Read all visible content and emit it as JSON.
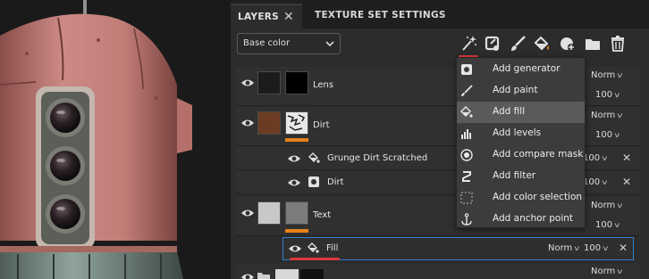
{
  "tabs": {
    "layers": "LAYERS",
    "layers_close": "✕",
    "texture_set_settings": "TEXTURE SET SETTINGS"
  },
  "channel": {
    "selected": "Base color"
  },
  "toolbar_icons": [
    "magic-wand-icon",
    "paint-bucket-add-icon",
    "brush-icon",
    "fill-icon",
    "mask-icon",
    "folder-icon",
    "trash-icon"
  ],
  "add_menu": {
    "items": [
      {
        "label": "Add generator",
        "icon": "generator-icon",
        "highlighted": false
      },
      {
        "label": "Add paint",
        "icon": "brush-icon",
        "highlighted": false
      },
      {
        "label": "Add fill",
        "icon": "fill-icon",
        "highlighted": true
      },
      {
        "label": "Add levels",
        "icon": "levels-icon",
        "highlighted": false
      },
      {
        "label": "Add compare mask",
        "icon": "compare-mask-icon",
        "highlighted": false
      },
      {
        "label": "Add filter",
        "icon": "filter-icon",
        "highlighted": false
      },
      {
        "label": "Add color selection",
        "icon": "color-selection-icon",
        "highlighted": false
      },
      {
        "label": "Add anchor point",
        "icon": "anchor-icon",
        "highlighted": false
      }
    ]
  },
  "layers": [
    {
      "name": "Lens",
      "blend": "Norm",
      "opacity": "100"
    },
    {
      "name": "Dirt",
      "blend": "Norm",
      "opacity": "100"
    },
    {
      "name": "Grunge Dirt Scratched",
      "opacity": "100",
      "close": "✕"
    },
    {
      "name": "Dirt",
      "opacity": "100",
      "close": "✕"
    },
    {
      "name": "Text",
      "blend": "Norm",
      "opacity": "100"
    },
    {
      "name": "Fill",
      "blend": "Norm",
      "opacity": "100",
      "close": "✕"
    },
    {
      "name": "",
      "blend": "Norm"
    }
  ],
  "colors": {
    "accent_orange": "#e7811b",
    "annotation_red": "#e0383b",
    "selection_blue": "#2e7fd1"
  }
}
